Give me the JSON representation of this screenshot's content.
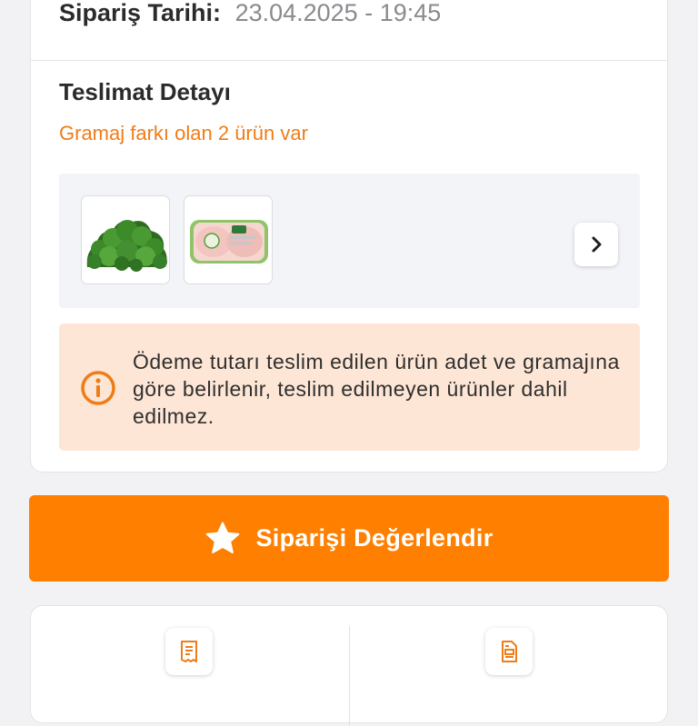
{
  "order": {
    "date_label": "Sipariş Tarihi:",
    "date_value": "23.04.2025 - 19:45"
  },
  "delivery": {
    "title": "Teslimat Detayı",
    "weight_diff_note": "Gramaj farkı olan 2 ürün var",
    "products": [
      {
        "name": "broccoli",
        "icon": "broccoli-image"
      },
      {
        "name": "chicken",
        "icon": "chicken-package-image"
      }
    ],
    "next_icon": "chevron-right-icon",
    "info_icon": "info-circle-icon",
    "info_text": "Ödeme tutarı teslim edilen ürün adet ve gramajına göre belirlenir, teslim edilmeyen ürünler dahil edilmez."
  },
  "rate_button": {
    "label": "Siparişi Değerlendir",
    "icon": "star-icon"
  },
  "actions": [
    {
      "label": "",
      "icon": "receipt-icon"
    },
    {
      "label": "",
      "icon": "invoice-icon"
    }
  ],
  "colors": {
    "accent": "#ff7f00",
    "note": "#f07c16",
    "info_bg": "#fde6d5",
    "strip_bg": "#f2f4f7"
  }
}
